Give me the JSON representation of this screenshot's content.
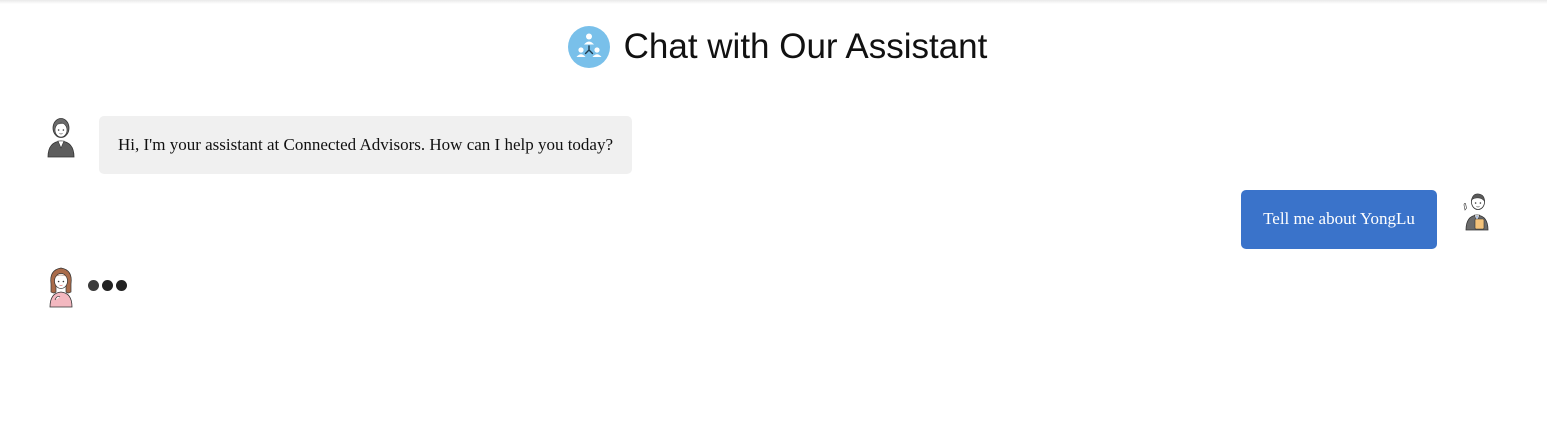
{
  "header": {
    "title": "Chat with Our Assistant",
    "logo_icon": "team-network-icon",
    "logo_color": "#79c0ea"
  },
  "messages": [
    {
      "role": "assistant",
      "avatar": "assistant-avatar-icon",
      "text": "Hi, I'm your assistant at Connected Advisors. How can I help you today?"
    },
    {
      "role": "user",
      "avatar": "user-avatar-icon",
      "text": "Tell me about YongLu"
    }
  ],
  "typing_indicator": {
    "avatar": "assistant-typing-avatar-icon",
    "dots": 3
  },
  "colors": {
    "assistant_bubble": "#f0f0f0",
    "user_bubble": "#3a73ca",
    "user_text": "#ffffff"
  }
}
